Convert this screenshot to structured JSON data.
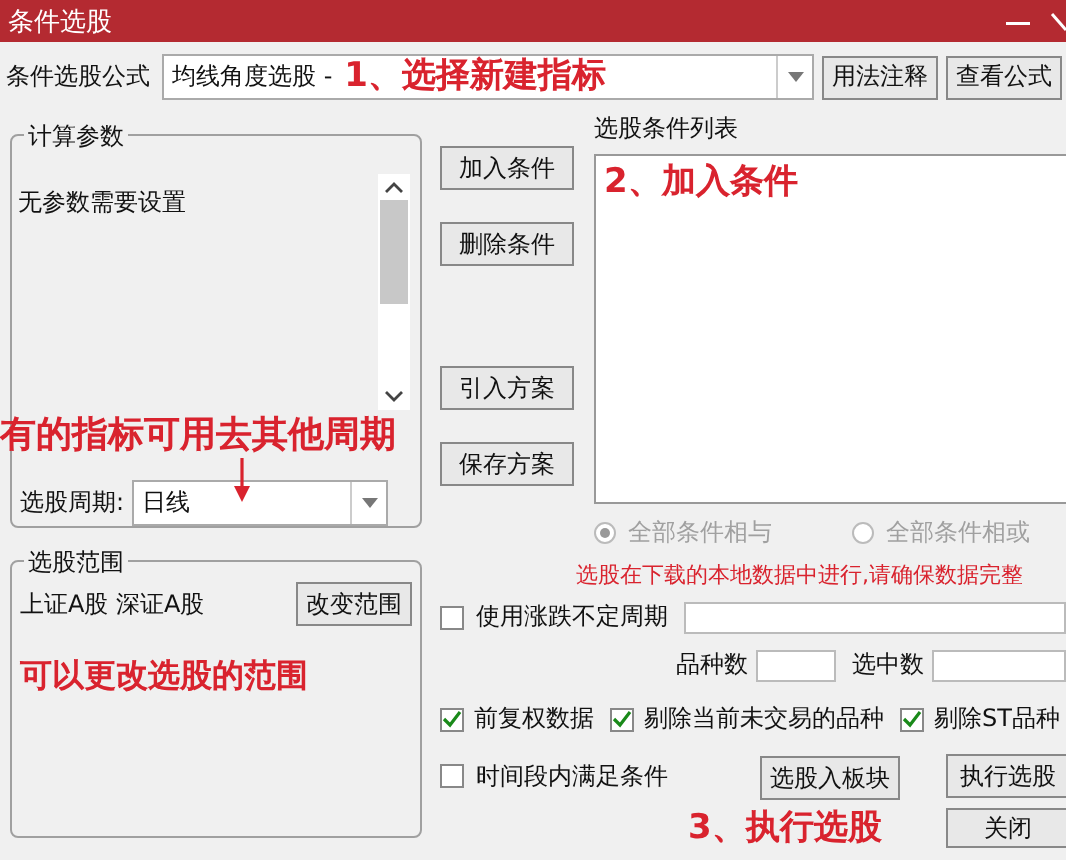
{
  "window": {
    "title": "条件选股"
  },
  "formula": {
    "label": "条件选股公式",
    "value": "均线角度选股 -",
    "annotation": "1、选择新建指标",
    "buttons": [
      "用法注释",
      "查看公式"
    ]
  },
  "params": {
    "title": "计算参数",
    "text": "无参数需要设置",
    "annotation": "有的指标可用去其他周期",
    "period": {
      "label": "选股周期:",
      "value": "日线"
    }
  },
  "condition_buttons": [
    "加入条件",
    "删除条件",
    "引入方案",
    "保存方案"
  ],
  "condition_list": {
    "label": "选股条件列表",
    "annotation": "2、加入条件"
  },
  "logic": [
    {
      "label": "全部条件相与",
      "selected": true,
      "disabled": true
    },
    {
      "label": "全部条件相或",
      "selected": false,
      "disabled": true
    }
  ],
  "range": {
    "title": "选股范围",
    "value": "上证A股 深证A股",
    "button": "改变范围",
    "annotation": "可以更改选股的范围"
  },
  "notice": "选股在下载的本地数据中进行,请确保数据完整",
  "variable_period": {
    "label": "使用涨跌不定周期",
    "checked": false
  },
  "counts": [
    {
      "label": "品种数"
    },
    {
      "label": "选中数"
    }
  ],
  "options": [
    {
      "label": "前复权数据",
      "checked": true
    },
    {
      "label": "剔除当前未交易的品种",
      "checked": true
    },
    {
      "label": "剔除ST品种",
      "checked": true
    }
  ],
  "time_condition": {
    "label": "时间段内满足条件",
    "checked": false
  },
  "actions": {
    "to_block": "选股入板块",
    "run": "执行选股",
    "close": "关闭",
    "annotation": "3、执行选股"
  }
}
